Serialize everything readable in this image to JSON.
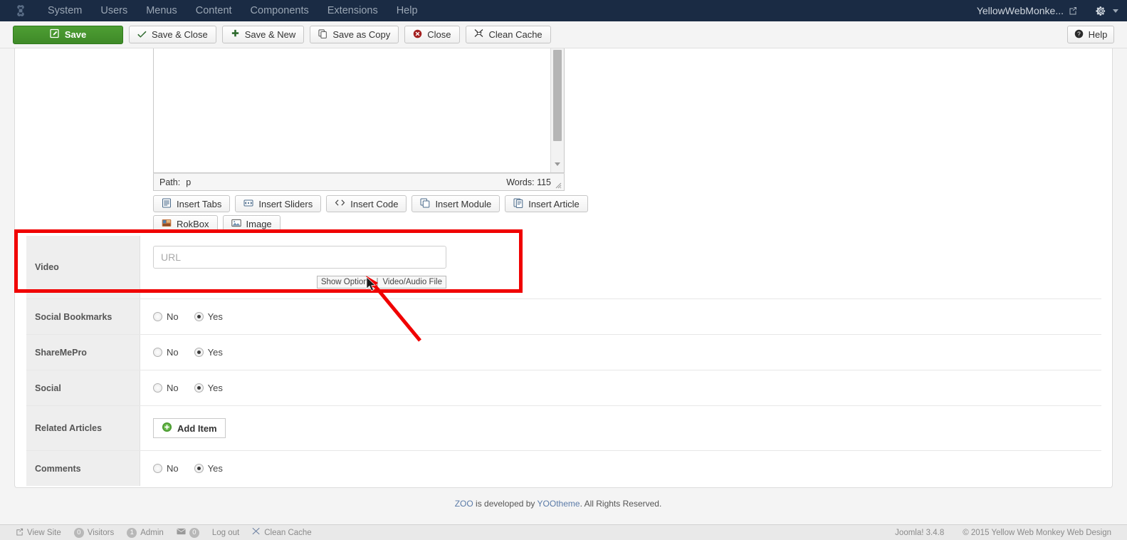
{
  "admin_bar": {
    "logo_icon": "joomla-logo-icon",
    "menu": [
      {
        "label": "System"
      },
      {
        "label": "Users"
      },
      {
        "label": "Menus"
      },
      {
        "label": "Content"
      },
      {
        "label": "Components"
      },
      {
        "label": "Extensions"
      },
      {
        "label": "Help"
      }
    ],
    "site_name": "YellowWebMonke...",
    "external_link_icon": "external-link-icon",
    "gear_icon": "gear-icon",
    "caret_icon": "chevron-down-icon"
  },
  "toolbar": {
    "save_label": "Save",
    "save_close_label": "Save & Close",
    "save_new_label": "Save & New",
    "save_copy_label": "Save as Copy",
    "close_label": "Close",
    "clean_cache_label": "Clean Cache",
    "help_label": "Help",
    "icons": {
      "save": "pencil-square-icon",
      "save_close": "check-icon",
      "save_new": "plus-icon",
      "save_copy": "copy-icon",
      "close": "close-circle-icon",
      "clean_cache": "broom-icon",
      "help": "question-circle-icon"
    }
  },
  "editor": {
    "path_label": "Path:",
    "path_value": "p",
    "words_label": "Words: 115",
    "content": ""
  },
  "insert_buttons": [
    {
      "label": "Insert Tabs",
      "icon": "tabs-icon"
    },
    {
      "label": "Insert Sliders",
      "icon": "sliders-icon"
    },
    {
      "label": "Insert Code",
      "icon": "code-icon"
    },
    {
      "label": "Insert Module",
      "icon": "module-icon"
    },
    {
      "label": "Insert Article",
      "icon": "article-icon"
    },
    {
      "label": "RokBox",
      "icon": "rokbox-icon"
    },
    {
      "label": "Image",
      "icon": "image-icon"
    }
  ],
  "form": {
    "video": {
      "label": "Video",
      "url_placeholder": "URL",
      "url_value": "",
      "show_options_label": "Show Options",
      "separator": "|",
      "video_audio_file_label": "Video/Audio File"
    },
    "rows": [
      {
        "label": "Social Bookmarks",
        "type": "radio",
        "options": [
          {
            "label": "No",
            "checked": false
          },
          {
            "label": "Yes",
            "checked": true
          }
        ]
      },
      {
        "label": "ShareMePro",
        "type": "radio",
        "options": [
          {
            "label": "No",
            "checked": false
          },
          {
            "label": "Yes",
            "checked": true
          }
        ]
      },
      {
        "label": "Social",
        "type": "radio",
        "options": [
          {
            "label": "No",
            "checked": false
          },
          {
            "label": "Yes",
            "checked": true
          }
        ]
      },
      {
        "label": "Related Articles",
        "type": "button",
        "button_label": "Add Item",
        "button_icon": "plus-circle-icon"
      },
      {
        "label": "Comments",
        "type": "radio",
        "options": [
          {
            "label": "No",
            "checked": false
          },
          {
            "label": "Yes",
            "checked": true
          }
        ]
      }
    ]
  },
  "footer": {
    "zoo_label": "ZOO",
    "mid_text": " is developed by ",
    "yootheme_label": "YOOtheme",
    "tail_text": ". All Rights Reserved."
  },
  "status_bar": {
    "view_site_label": "View Site",
    "view_site_icon": "external-link-icon",
    "visitors_count": "0",
    "visitors_label": "Visitors",
    "admin_count": "1",
    "admin_label": "Admin",
    "messages_icon": "envelope-icon",
    "messages_count": "0",
    "logout_label": "Log out",
    "clean_cache_icon": "broom-icon",
    "clean_cache_label": "Clean Cache",
    "version_label": "Joomla! 3.4.8",
    "copyright_label": "© 2015 Yellow Web Monkey Web Design"
  },
  "annotation": {
    "highlight_color": "#f00000",
    "shape": "rectangle-and-arrow"
  }
}
